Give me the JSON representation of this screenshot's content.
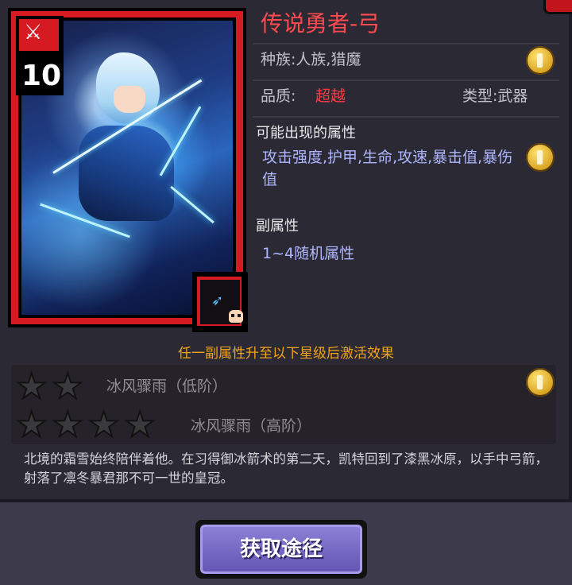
{
  "item": {
    "level": "10",
    "name": "传说勇者-弓",
    "race": "种族:人族,猎魔",
    "quality_label": "品质:",
    "quality_value": "超越",
    "type": "类型:武器"
  },
  "attributes": {
    "possible_header": "可能出现的属性",
    "possible_values": "攻击强度,护甲,生命,攻速,暴击值,暴伤值",
    "sub_header": "副属性",
    "sub_value": "1~4随机属性"
  },
  "activation": {
    "header": "任一副属性升至以下星级后激活效果",
    "tiers": [
      {
        "stars": 2,
        "name": "冰风骤雨（低阶）"
      },
      {
        "stars": 4,
        "name": "冰风骤雨（高阶）"
      }
    ]
  },
  "lore": "北境的霜雪始终陪伴着他。在习得御冰箭术的第二天，凯特回到了漆黑冰原，以手中弓箭，射落了凛冬暴君那不可一世的皇冠。",
  "actions": {
    "obtain_label": "获取途径"
  },
  "colors": {
    "card_border": "#d51a22",
    "title": "#ff4a4f",
    "quality": "#ff3b42",
    "attribute_text": "#aeb6ff",
    "activation_header": "#f2a41c",
    "button": "#7568c4"
  },
  "icons": [
    "sword-icon",
    "bow-icon",
    "skull-icon",
    "coin-icon",
    "star-icon",
    "close-corner"
  ]
}
